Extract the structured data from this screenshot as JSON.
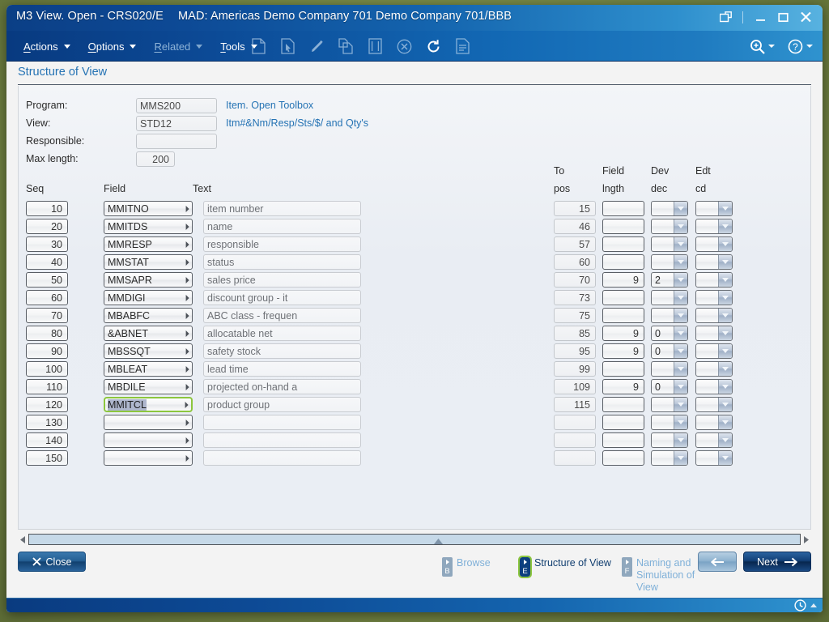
{
  "window": {
    "title_main": "M3 View. Open - CRS020/E",
    "title_sub": "MAD: Americas Demo Company 701 Demo Company 701/BBB",
    "restore_icon": "external-window-icon",
    "minimize": "–",
    "maximize": "❑",
    "close": "✕"
  },
  "menubar": {
    "items": [
      {
        "label": "Actions",
        "mnemonic": "A",
        "enabled": true
      },
      {
        "label": "Options",
        "mnemonic": "O",
        "enabled": true
      },
      {
        "label": "Related",
        "mnemonic": "R",
        "enabled": false
      },
      {
        "label": "Tools",
        "mnemonic": "T",
        "enabled": true
      }
    ],
    "icons": [
      "new-document-icon",
      "select-document-icon",
      "edit-pencil-icon",
      "copy-document-icon",
      "display-document-icon",
      "delete-circle-icon",
      "refresh-icon",
      "details-document-icon"
    ],
    "right_icons": [
      "zoom-search-icon",
      "help-icon"
    ]
  },
  "panel": {
    "title": "Structure of View"
  },
  "header_form": {
    "program_label": "Program:",
    "program_value": "MMS200",
    "program_desc": "Item. Open Toolbox",
    "view_label": "View:",
    "view_value": "STD12",
    "view_desc": "Itm#&Nm/Resp/Sts/$/ and Qty's",
    "responsible_label": "Responsible:",
    "responsible_value": "",
    "maxlength_label": "Max length:",
    "maxlength_value": "200"
  },
  "table": {
    "columns": {
      "seq": "Seq",
      "field": "Field",
      "text": "Text",
      "topos_1": "To",
      "topos_2": "pos",
      "fieldlngth_1": "Field",
      "fieldlngth_2": "lngth",
      "devdec_1": "Dev",
      "devdec_2": "dec",
      "edtcd_1": "Edt",
      "edtcd_2": "cd"
    },
    "rows": [
      {
        "seq": "10",
        "field": "MMITNO",
        "text": "item number",
        "to_pos": "15",
        "field_lngth": "",
        "dev_dec": "",
        "edt_cd": "",
        "focused": false
      },
      {
        "seq": "20",
        "field": "MMITDS",
        "text": "name",
        "to_pos": "46",
        "field_lngth": "",
        "dev_dec": "",
        "edt_cd": "",
        "focused": false
      },
      {
        "seq": "30",
        "field": "MMRESP",
        "text": "responsible",
        "to_pos": "57",
        "field_lngth": "",
        "dev_dec": "",
        "edt_cd": "",
        "focused": false
      },
      {
        "seq": "40",
        "field": "MMSTAT",
        "text": "status",
        "to_pos": "60",
        "field_lngth": "",
        "dev_dec": "",
        "edt_cd": "",
        "focused": false
      },
      {
        "seq": "50",
        "field": "MMSAPR",
        "text": "sales price",
        "to_pos": "70",
        "field_lngth": "9",
        "dev_dec": "2",
        "edt_cd": "",
        "focused": false
      },
      {
        "seq": "60",
        "field": "MMDIGI",
        "text": "discount group - it",
        "to_pos": "73",
        "field_lngth": "",
        "dev_dec": "",
        "edt_cd": "",
        "focused": false
      },
      {
        "seq": "70",
        "field": "MBABFC",
        "text": "ABC class - frequen",
        "to_pos": "75",
        "field_lngth": "",
        "dev_dec": "",
        "edt_cd": "",
        "focused": false
      },
      {
        "seq": "80",
        "field": "&ABNET",
        "text": "allocatable net",
        "to_pos": "85",
        "field_lngth": "9",
        "dev_dec": "0",
        "edt_cd": "",
        "focused": false
      },
      {
        "seq": "90",
        "field": "MBSSQT",
        "text": "safety stock",
        "to_pos": "95",
        "field_lngth": "9",
        "dev_dec": "0",
        "edt_cd": "",
        "focused": false
      },
      {
        "seq": "100",
        "field": "MBLEAT",
        "text": "lead time",
        "to_pos": "99",
        "field_lngth": "",
        "dev_dec": "",
        "edt_cd": "",
        "focused": false
      },
      {
        "seq": "110",
        "field": "MBDILE",
        "text": "projected on-hand a",
        "to_pos": "109",
        "field_lngth": "9",
        "dev_dec": "0",
        "edt_cd": "",
        "focused": false
      },
      {
        "seq": "120",
        "field": "MMITCL",
        "text": "product group",
        "to_pos": "115",
        "field_lngth": "",
        "dev_dec": "",
        "edt_cd": "",
        "focused": true
      },
      {
        "seq": "130",
        "field": "",
        "text": "",
        "to_pos": "",
        "field_lngth": "",
        "dev_dec": "",
        "edt_cd": "",
        "focused": false
      },
      {
        "seq": "140",
        "field": "",
        "text": "",
        "to_pos": "",
        "field_lngth": "",
        "dev_dec": "",
        "edt_cd": "",
        "focused": false
      },
      {
        "seq": "150",
        "field": "",
        "text": "",
        "to_pos": "",
        "field_lngth": "",
        "dev_dec": "",
        "edt_cd": "",
        "focused": false
      }
    ]
  },
  "footer": {
    "close_label": "Close",
    "close_icon": "x-icon",
    "back_icon": "arrow-left-icon",
    "next_label": "Next",
    "next_icon": "arrow-right-icon"
  },
  "panel_tabs": [
    {
      "key": "B",
      "label": "Browse",
      "active": false
    },
    {
      "key": "E",
      "label": "Structure of View",
      "active": true
    },
    {
      "key": "F",
      "label": "Naming and Simulation of View",
      "active": false
    }
  ],
  "statusbar": {
    "clock_icon": "clock-icon"
  },
  "colors": {
    "accent_blue": "#1464ae",
    "link_blue": "#2573b4",
    "desktop_green": "#7d8e4a",
    "focus_green": "#8cc63e",
    "selection": "#aeb6cd"
  }
}
